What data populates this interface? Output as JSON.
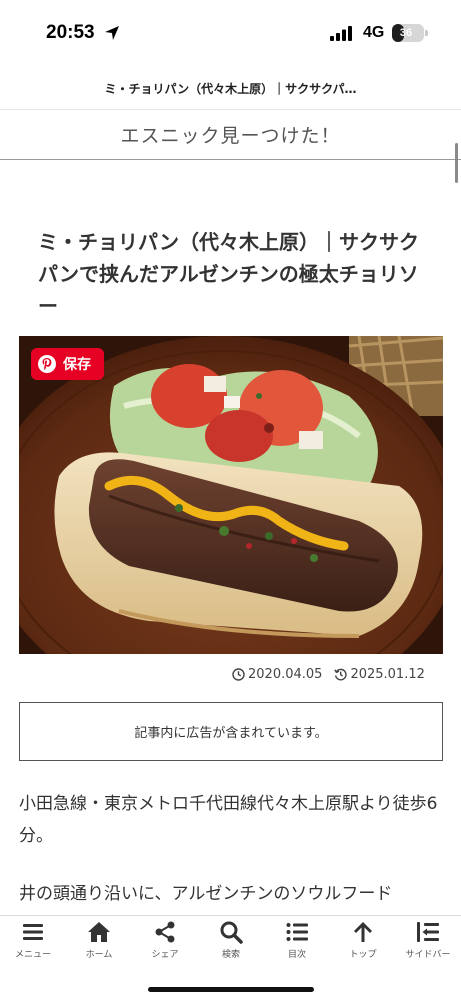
{
  "status_bar": {
    "time": "20:53",
    "network": "4G",
    "battery": "36",
    "battery_level": 0.36
  },
  "browser": {
    "url_title": "ミ・チョリパン（代々木上原）｜サクサクパ…"
  },
  "site": {
    "title": "エスニック見ーつけた！"
  },
  "article": {
    "title": "ミ・チョリパン（代々木上原）｜サクサクパンで挟んだアルゼンチンの極太チョリソー",
    "save_label": "保存",
    "published": "2020.04.05",
    "updated": "2025.01.12",
    "ad_notice": "記事内に広告が含まれています。",
    "paragraph_1": "小田急線・東京メトロ千代田線代々木上原駅より徒歩6分。",
    "paragraph_2": "井の頭通り沿いに、アルゼンチンのソウルフード"
  },
  "bottom_nav": [
    {
      "label": "メニュー",
      "icon": "menu-icon"
    },
    {
      "label": "ホーム",
      "icon": "home-icon"
    },
    {
      "label": "シェア",
      "icon": "share-icon"
    },
    {
      "label": "検索",
      "icon": "search-icon"
    },
    {
      "label": "目次",
      "icon": "toc-icon"
    },
    {
      "label": "トップ",
      "icon": "arrow-up-icon"
    },
    {
      "label": "サイドバー",
      "icon": "sidebar-icon"
    }
  ]
}
